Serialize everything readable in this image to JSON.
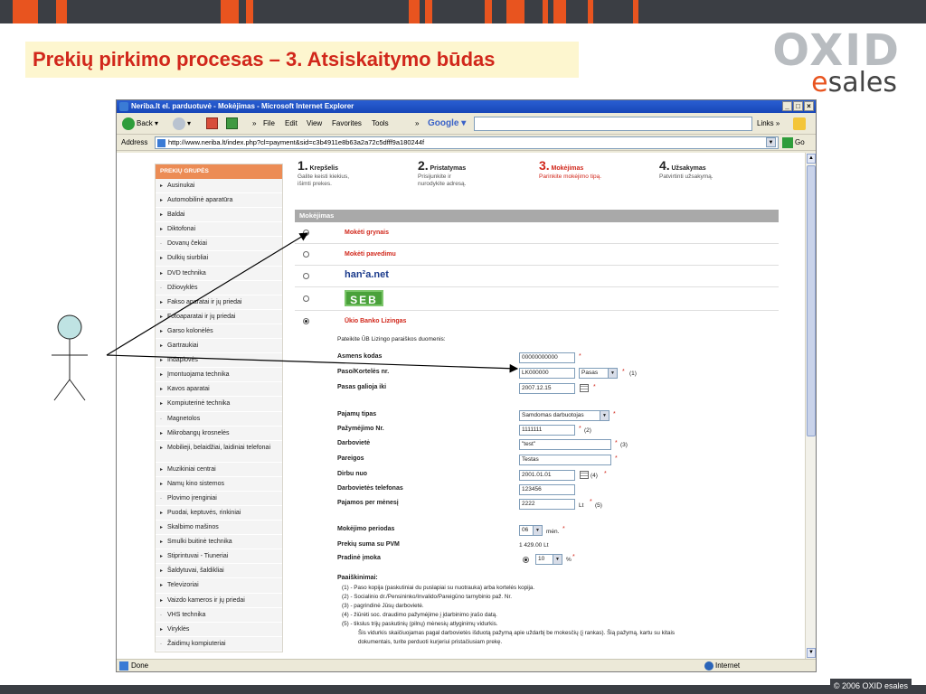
{
  "slide": {
    "title": "Prekių pirkimo procesas – 3. Atsiskaitymo būdas",
    "logo_top": "OXID",
    "logo_bottom_e": "e",
    "logo_bottom_rest": "sales",
    "copyright": "© 2006 OXID esales",
    "colors": {
      "accent": "#e8541f",
      "title": "#d1271b",
      "dark": "#3b3e44"
    }
  },
  "browser": {
    "title": "Neriba.lt el. parduotuvė - Mokėjimas - Microsoft Internet Explorer",
    "toolbar": {
      "back": "Back",
      "menus": [
        "File",
        "Edit",
        "View",
        "Favorites",
        "Tools"
      ],
      "google": "Google",
      "links": "Links"
    },
    "address_label": "Address",
    "url": "http://www.neriba.lt/index.php?cl=payment&sid=c3b4911e8b63a2a72c5dfff9a180244f",
    "go": "Go",
    "status": "Done",
    "zone": "Internet"
  },
  "sidebar": {
    "heading": "PREKIŲ GRUPĖS",
    "items": [
      {
        "label": "Ausinukai",
        "marker": "▸"
      },
      {
        "label": "Automobilinė aparatūra",
        "marker": "▸"
      },
      {
        "label": "Baldai",
        "marker": "▸"
      },
      {
        "label": "Diktofonai",
        "marker": "▸"
      },
      {
        "label": "Dovanų čekiai",
        "marker": "·"
      },
      {
        "label": "Dulkių siurbliai",
        "marker": "▸"
      },
      {
        "label": "DVD technika",
        "marker": "▸"
      },
      {
        "label": "Džiovyklės",
        "marker": "·"
      },
      {
        "label": "Fakso aparatai ir jų priedai",
        "marker": "▸"
      },
      {
        "label": "Fotoaparatai ir jų priedai",
        "marker": "▸"
      },
      {
        "label": "Garso kolonėlės",
        "marker": "▸"
      },
      {
        "label": "Gartraukiai",
        "marker": "▸"
      },
      {
        "label": "Indaplovės",
        "marker": "▸"
      },
      {
        "label": "Įmontuojama technika",
        "marker": "▸"
      },
      {
        "label": "Kavos aparatai",
        "marker": "▸"
      },
      {
        "label": "Kompiuterinė technika",
        "marker": "▸"
      },
      {
        "label": "Magnetolos",
        "marker": "·"
      },
      {
        "label": "Mikrobangų krosnelės",
        "marker": "▸"
      },
      {
        "label": "Mobilieji, belaidžiai, laidiniai telefonai",
        "marker": "▸",
        "two": true
      },
      {
        "label": "Muzikiniai centrai",
        "marker": "▸"
      },
      {
        "label": "Namų kino sistemos",
        "marker": "▸"
      },
      {
        "label": "Plovimo įrenginiai",
        "marker": "·"
      },
      {
        "label": "Puodai, keptuvės, rinkiniai",
        "marker": "▸"
      },
      {
        "label": "Skalbimo mašinos",
        "marker": "▸"
      },
      {
        "label": "Smulki buitinė technika",
        "marker": "▸"
      },
      {
        "label": "Stiprintuvai - Tiuneriai",
        "marker": "▸"
      },
      {
        "label": "Šaldytuvai, šaldikliai",
        "marker": "▸"
      },
      {
        "label": "Televizoriai",
        "marker": "▸"
      },
      {
        "label": "Vaizdo kameros ir jų priedai",
        "marker": "▸"
      },
      {
        "label": "VHS technika",
        "marker": "·"
      },
      {
        "label": "Viryklės",
        "marker": "▸"
      },
      {
        "label": "Žaidimų kompiuteriai",
        "marker": "·"
      }
    ]
  },
  "steps": [
    {
      "num": "1.",
      "label": "Krepšelis",
      "desc1": "Galite keisti kiekius,",
      "desc2": "išimti prekes."
    },
    {
      "num": "2.",
      "label": "Pristatymas",
      "desc1": "Prisijunkite ir",
      "desc2": "nurodykite adresą."
    },
    {
      "num": "3.",
      "label": "Mokėjimas",
      "desc1": "Parinkite mokėjimo tipą.",
      "desc2": ""
    },
    {
      "num": "4.",
      "label": "Užsakymas",
      "desc1": "Patvirtinti užsakymą.",
      "desc2": ""
    }
  ],
  "payment": {
    "heading": "Mokėjimas",
    "opt_cash": "Mokėti grynais",
    "opt_transfer": "Mokėti pavedimu",
    "opt_hansa": "han²a.net",
    "opt_seb": "SEB",
    "opt_ukio": "Ūkio Banko Lizingas",
    "intro": "Pateikite ŪB Lizingo paraiškos duomenis:",
    "fields": {
      "asmens_kodas": {
        "label": "Asmens kodas",
        "value": "00000000000"
      },
      "paso_nr": {
        "label": "Paso/Kortelės nr.",
        "value": "LK000000",
        "select": "Pasas",
        "note": "(1)"
      },
      "paso_galioja": {
        "label": "Pasas galioja iki",
        "value": "2007.12.15"
      },
      "pajamu_tipas": {
        "label": "Pajamų tipas",
        "select": "Samdomas darbuotojas"
      },
      "pazymejimo_nr": {
        "label": "Pažymėjimo Nr.",
        "value": "1111111",
        "note": "(2)"
      },
      "darboviete": {
        "label": "Darbovietė",
        "value": "\"test\"",
        "note": "(3)"
      },
      "pareigos": {
        "label": "Pareigos",
        "value": "Testas"
      },
      "dirbu_nuo": {
        "label": "Dirbu nuo",
        "value": "2001.01.01",
        "note": "(4)"
      },
      "darbovietes_tel": {
        "label": "Darbovietės telefonas",
        "value": "123456"
      },
      "pajamos": {
        "label": "Pajamos per mėnesį",
        "value": "2222",
        "unit": "Lt",
        "note": "(5)"
      },
      "laikotarpis": {
        "label": "Mokėjimo periodas",
        "select": "06",
        "unit": "mėn."
      },
      "suma": {
        "label": "Prekių suma su PVM",
        "value": "1 429.00 Lt"
      },
      "imoka": {
        "label": "Pradinė įmoka",
        "select": "10",
        "unit": "%"
      }
    },
    "required_mark": "*",
    "explanations_heading": "Paaiškinimai:",
    "explanations": [
      "(1) - Paso kopija (paskutiniai du puslapiai su nuotrauka) arba kortelės kopija.",
      "(2) - Socialinio dr./Pensininko/Invalido/Pareigūno tarnybinio paž. Nr.",
      "(3) - pagrindinė Jūsų darbovietė.",
      "(4) - žiūrėti soc. draudimo pažymėjime į įdarbinimo įrašo datą.",
      "(5) - tikslus trijų paskutinių (pilnų) mėnesių atlyginimų vidurkis.",
      "Šis vidurkis skaičiuojamas pagal darbovietės išduotą pažymą apie uždarbį be mokesčių (į rankas). Šią pažymą, kartu su kitais",
      "dokumentais, turite perduoti kurjeriui pristačiusiam prekę."
    ]
  }
}
